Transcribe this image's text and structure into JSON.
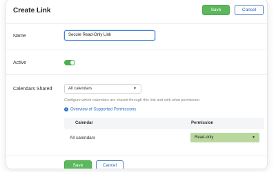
{
  "dialog": {
    "title": "Create Link",
    "header_save": "Save",
    "header_cancel": "Cancel",
    "footer_save": "Save",
    "footer_cancel": "Cancel"
  },
  "form": {
    "name_label": "Name",
    "name_value": "Secure Read-Only Link",
    "active_label": "Active",
    "active_on": true,
    "calendars_label": "Calendars Shared",
    "calendars_select": "All calendars",
    "help_text": "Configure which calendars are shared through this link and with what permission.",
    "overview_link": "Overview of Supported Permissions"
  },
  "table": {
    "columns": [
      "Calendar",
      "Permission"
    ],
    "rows": [
      {
        "calendar": "All calendars",
        "permission": "Read-only"
      }
    ]
  },
  "colors": {
    "save": "#5cb85c",
    "link": "#2a72c4",
    "permission_bg": "#b9d89e",
    "toggle_on": "#4caf50"
  },
  "icons": {
    "info": "info-circle-icon",
    "dropdown": "caret-down-icon"
  }
}
